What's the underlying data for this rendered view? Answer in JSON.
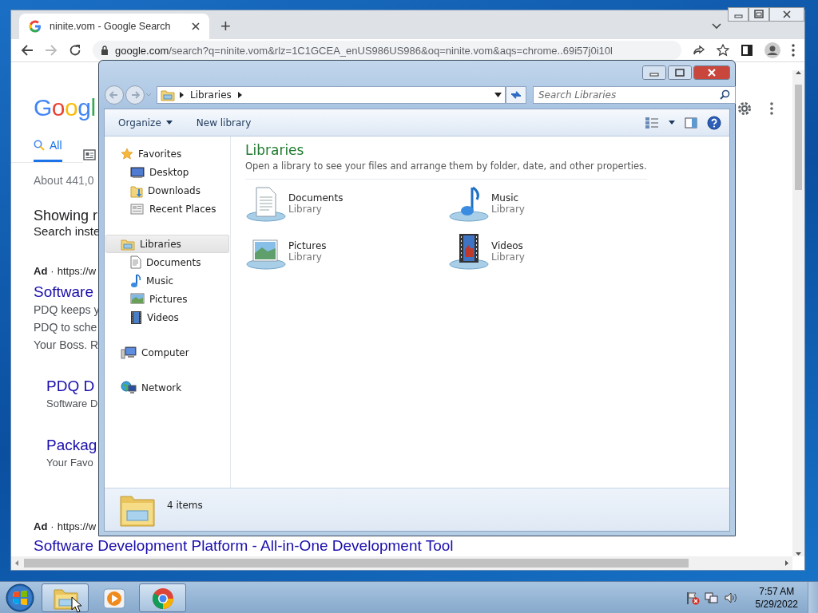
{
  "browser": {
    "tab_title": "ninite.vom - Google Search",
    "new_tab": "+",
    "url_domain": "google.com",
    "url_path": "/search?q=ninite.vom&rlz=1C1GCEA_enUS986US986&oq=ninite.vom&aqs=chrome..69i57j0i10l"
  },
  "search_page": {
    "logo": "Googl",
    "tabs": [
      {
        "label": "All",
        "selected": true
      }
    ],
    "result_stats": "About 441,0",
    "showing": "Showing r",
    "search_instead": "Search inste",
    "results": [
      {
        "kind": "ad",
        "ad_label": "Ad",
        "separator": "·",
        "url": "https://w",
        "title": "Software",
        "lines": [
          "PDQ keeps y",
          "PDQ to sche",
          "Your Boss. R"
        ]
      },
      {
        "kind": "sitelink",
        "title": "PDQ D",
        "lines": [
          "Software D"
        ]
      },
      {
        "kind": "sitelink",
        "title": "Packag",
        "lines": [
          "Your Favo"
        ]
      },
      {
        "kind": "ad",
        "ad_label": "Ad",
        "separator": "·",
        "url": "https://w",
        "title": "Software Development Platform - All-in-One Development Tool"
      }
    ]
  },
  "explorer": {
    "breadcrumb": "Libraries",
    "search": {
      "placeholder": "Search Libraries"
    },
    "toolbar": [
      "Organize",
      "New library"
    ],
    "nav": [
      {
        "label": "Favorites",
        "selected": false,
        "children": [
          {
            "label": "Desktop",
            "selected": false
          },
          {
            "label": "Downloads",
            "selected": false
          },
          {
            "label": "Recent Places",
            "selected": false
          }
        ]
      },
      {
        "label": "Libraries",
        "selected": true,
        "children": [
          {
            "label": "Documents",
            "selected": false
          },
          {
            "label": "Music",
            "selected": false
          },
          {
            "label": "Pictures",
            "selected": false
          },
          {
            "label": "Videos",
            "selected": false
          }
        ]
      },
      {
        "label": "Computer",
        "selected": false
      },
      {
        "label": "Network",
        "selected": false
      }
    ],
    "heading": "Libraries",
    "description": "Open a library to see your files and arrange them by folder, date, and other properties.",
    "items": [
      {
        "name": "Documents",
        "type": "Library"
      },
      {
        "name": "Music",
        "type": "Library"
      },
      {
        "name": "Pictures",
        "type": "Library"
      },
      {
        "name": "Videos",
        "type": "Library"
      }
    ],
    "status": "4 items"
  },
  "taskbar": {
    "apps": [
      {
        "kind": "explorer",
        "open": true
      },
      {
        "kind": "media",
        "open": false
      },
      {
        "kind": "browser",
        "open": true
      }
    ],
    "time": "7:57 AM",
    "date": "5/29/2022"
  }
}
